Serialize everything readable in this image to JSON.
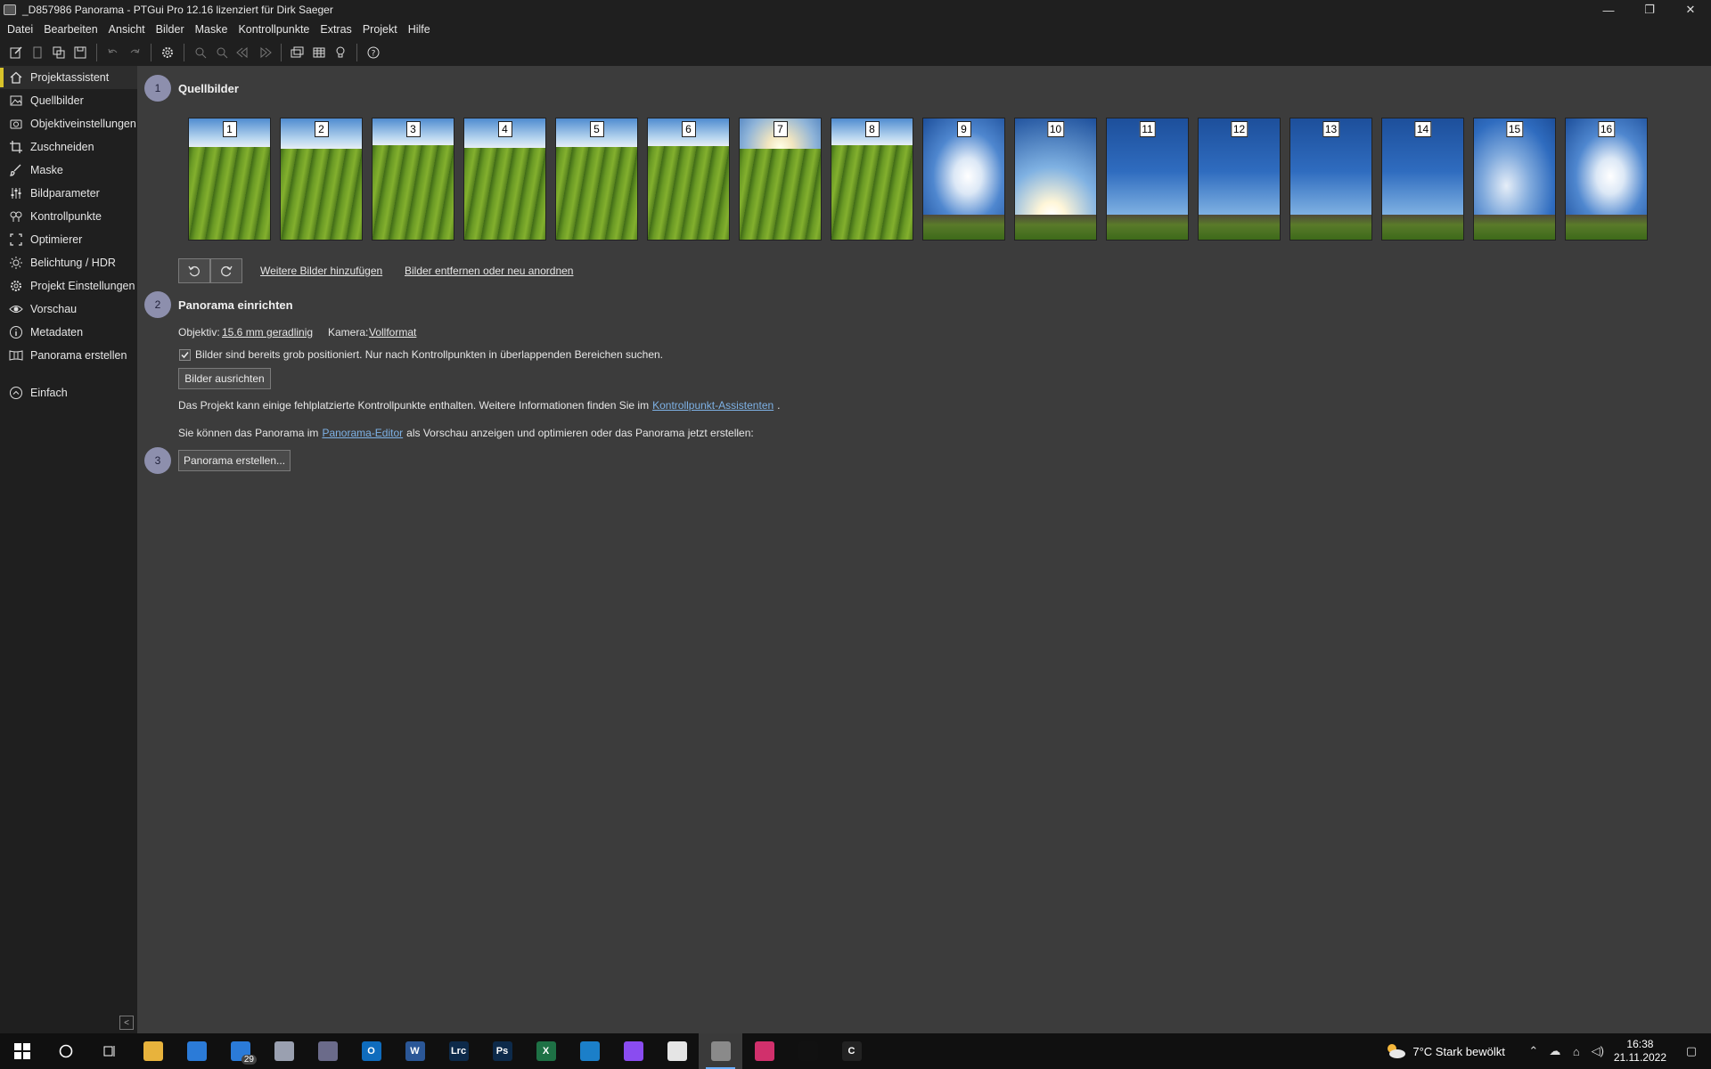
{
  "window": {
    "title": "_D857986 Panorama - PTGui Pro 12.16 lizenziert für Dirk Saeger",
    "minimize": "—",
    "restore": "❐",
    "close": "✕"
  },
  "menu": [
    "Datei",
    "Bearbeiten",
    "Ansicht",
    "Bilder",
    "Maske",
    "Kontrollpunkte",
    "Extras",
    "Projekt",
    "Hilfe"
  ],
  "toolbar": {
    "icons": [
      "new-project-icon",
      "open-project-icon",
      "copy-icon",
      "save-icon",
      "undo-icon",
      "redo-icon",
      "settings-icon",
      "zoom-in-icon",
      "zoom-out-icon",
      "prev-icon",
      "next-icon",
      "panorama-editor-icon",
      "table-icon",
      "bulb-icon",
      "help-icon"
    ]
  },
  "sidebar": {
    "items": [
      {
        "label": "Projektassistent",
        "icon": "home-icon",
        "active": true
      },
      {
        "label": "Quellbilder",
        "icon": "image-icon"
      },
      {
        "label": "Objektiveinstellungen",
        "icon": "camera-icon"
      },
      {
        "label": "Zuschneiden",
        "icon": "crop-icon"
      },
      {
        "label": "Maske",
        "icon": "brush-icon"
      },
      {
        "label": "Bildparameter",
        "icon": "sliders-icon"
      },
      {
        "label": "Kontrollpunkte",
        "icon": "control-points-icon"
      },
      {
        "label": "Optimierer",
        "icon": "optimizer-icon"
      },
      {
        "label": "Belichtung / HDR",
        "icon": "sun-icon"
      },
      {
        "label": "Projekt Einstellungen",
        "icon": "gear-icon"
      },
      {
        "label": "Vorschau",
        "icon": "eye-icon"
      },
      {
        "label": "Metadaten",
        "icon": "info-icon"
      },
      {
        "label": "Panorama erstellen",
        "icon": "panorama-icon"
      }
    ],
    "mode": {
      "label": "Einfach",
      "icon": "chevron-up-circle-icon"
    },
    "collapse": "<"
  },
  "step1": {
    "number": "1",
    "title": "Quellbilder",
    "images": [
      "1",
      "2",
      "3",
      "4",
      "5",
      "6",
      "7",
      "8",
      "9",
      "10",
      "11",
      "12",
      "13",
      "14",
      "15",
      "16"
    ],
    "add_link": "Weitere Bilder hinzufügen",
    "remove_link": "Bilder entfernen oder neu anordnen"
  },
  "step2": {
    "number": "2",
    "title": "Panorama einrichten",
    "lens_label": "Objektiv:",
    "lens_value": "15.6 mm geradlinig",
    "camera_label": "Kamera:",
    "camera_value": "Vollformat",
    "checkbox_label": "Bilder sind bereits grob positioniert. Nur nach Kontrollpunkten in überlappenden Bereichen suchen.",
    "checkbox_checked": true,
    "align_button": "Bilder ausrichten",
    "warning_text": "Das Projekt kann einige fehlplatzierte Kontrollpunkte enthalten. Weitere Informationen finden Sie im",
    "warning_link": "Kontrollpunkt-Assistenten",
    "warning_end": ".",
    "editor_text_a": "Sie können das Panorama im",
    "editor_link": "Panorama-Editor",
    "editor_text_b": "als Vorschau anzeigen und optimieren oder das Panorama jetzt erstellen:"
  },
  "step3": {
    "number": "3",
    "create_button": "Panorama erstellen..."
  },
  "taskbar": {
    "apps": [
      {
        "name": "windows-start-icon",
        "label": ""
      },
      {
        "name": "search-circle-icon",
        "label": ""
      },
      {
        "name": "task-view-icon",
        "label": ""
      },
      {
        "name": "file-explorer-icon",
        "label": ""
      },
      {
        "name": "store-icon",
        "label": ""
      },
      {
        "name": "mail-icon",
        "label": "",
        "badge": "29"
      },
      {
        "name": "network-icon",
        "label": ""
      },
      {
        "name": "calculator-icon",
        "label": ""
      },
      {
        "name": "outlook-icon",
        "label": "O"
      },
      {
        "name": "word-icon",
        "label": "W"
      },
      {
        "name": "lightroom-icon",
        "label": "Lrc"
      },
      {
        "name": "photoshop-icon",
        "label": "Ps"
      },
      {
        "name": "excel-icon",
        "label": "X"
      },
      {
        "name": "edge-icon",
        "label": ""
      },
      {
        "name": "messenger-icon",
        "label": ""
      },
      {
        "name": "app-y-icon",
        "label": ""
      },
      {
        "name": "ptgui-icon",
        "label": "",
        "active": true
      },
      {
        "name": "instagram-icon",
        "label": ""
      },
      {
        "name": "app-q-icon",
        "label": ""
      },
      {
        "name": "app-c-icon",
        "label": "C"
      }
    ],
    "weather": "7°C  Stark bewölkt",
    "time": "16:38",
    "date": "21.11.2022"
  },
  "colors": {
    "accent": "#d8c32a",
    "link": "#7eb2e6",
    "badge": "#8d8fad",
    "chrome": "#1f1f1f",
    "content": "#3c3c3c"
  }
}
